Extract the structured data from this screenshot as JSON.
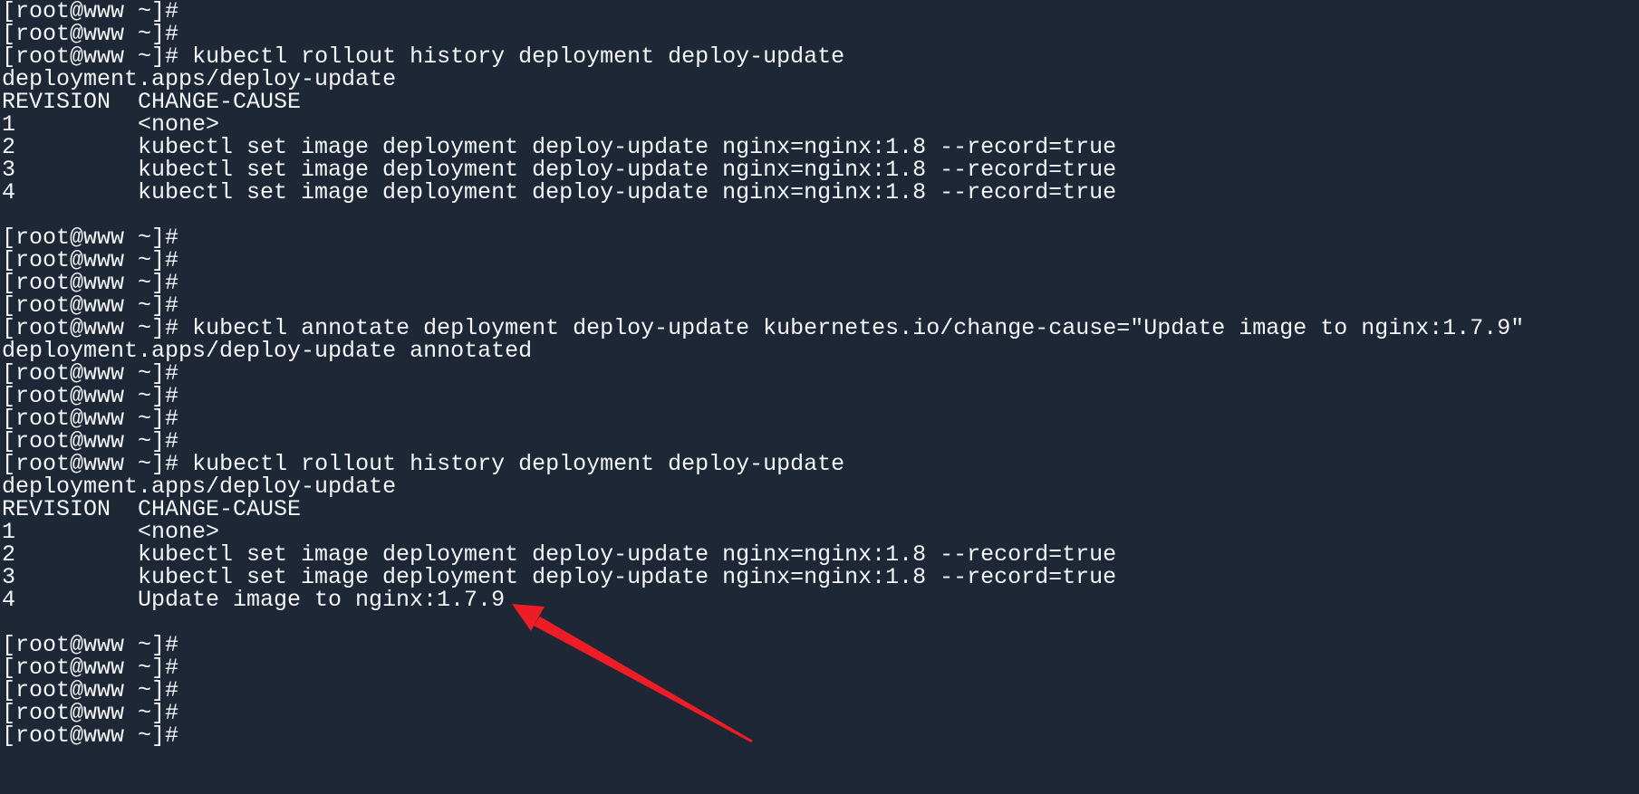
{
  "terminal": {
    "prompt": "[root@www ~]#",
    "colors": {
      "background": "#1e2735",
      "foreground": "#f4f6f8",
      "annotation_arrow": "#ee1c25"
    },
    "lines": [
      {
        "type": "prompt",
        "cmd": ""
      },
      {
        "type": "prompt",
        "cmd": ""
      },
      {
        "type": "prompt",
        "cmd": "kubectl rollout history deployment deploy-update"
      },
      {
        "type": "output",
        "text": "deployment.apps/deploy-update"
      },
      {
        "type": "table-header",
        "revision": "REVISION",
        "cause": "CHANGE-CAUSE"
      },
      {
        "type": "table-row",
        "revision": "1",
        "cause": "<none>"
      },
      {
        "type": "table-row",
        "revision": "2",
        "cause": "kubectl set image deployment deploy-update nginx=nginx:1.8 --record=true"
      },
      {
        "type": "table-row",
        "revision": "3",
        "cause": "kubectl set image deployment deploy-update nginx=nginx:1.8 --record=true"
      },
      {
        "type": "table-row",
        "revision": "4",
        "cause": "kubectl set image deployment deploy-update nginx=nginx:1.8 --record=true"
      },
      {
        "type": "blank",
        "text": ""
      },
      {
        "type": "prompt",
        "cmd": ""
      },
      {
        "type": "prompt",
        "cmd": ""
      },
      {
        "type": "prompt",
        "cmd": ""
      },
      {
        "type": "prompt",
        "cmd": ""
      },
      {
        "type": "prompt",
        "cmd": "kubectl annotate deployment deploy-update kubernetes.io/change-cause=\"Update image to nginx:1.7.9\""
      },
      {
        "type": "output",
        "text": "deployment.apps/deploy-update annotated"
      },
      {
        "type": "prompt",
        "cmd": ""
      },
      {
        "type": "prompt",
        "cmd": ""
      },
      {
        "type": "prompt",
        "cmd": ""
      },
      {
        "type": "prompt",
        "cmd": ""
      },
      {
        "type": "prompt",
        "cmd": "kubectl rollout history deployment deploy-update"
      },
      {
        "type": "output",
        "text": "deployment.apps/deploy-update"
      },
      {
        "type": "table-header",
        "revision": "REVISION",
        "cause": "CHANGE-CAUSE"
      },
      {
        "type": "table-row",
        "revision": "1",
        "cause": "<none>"
      },
      {
        "type": "table-row",
        "revision": "2",
        "cause": "kubectl set image deployment deploy-update nginx=nginx:1.8 --record=true"
      },
      {
        "type": "table-row",
        "revision": "3",
        "cause": "kubectl set image deployment deploy-update nginx=nginx:1.8 --record=true"
      },
      {
        "type": "table-row",
        "revision": "4",
        "cause": "Update image to nginx:1.7.9",
        "highlighted": true
      },
      {
        "type": "blank",
        "text": ""
      },
      {
        "type": "prompt",
        "cmd": ""
      },
      {
        "type": "prompt",
        "cmd": ""
      },
      {
        "type": "prompt",
        "cmd": ""
      },
      {
        "type": "prompt",
        "cmd": ""
      },
      {
        "type": "prompt",
        "cmd": ""
      }
    ]
  },
  "annotation": {
    "icon": "red-arrow-icon",
    "points_to": "Update image to nginx:1.7.9"
  }
}
